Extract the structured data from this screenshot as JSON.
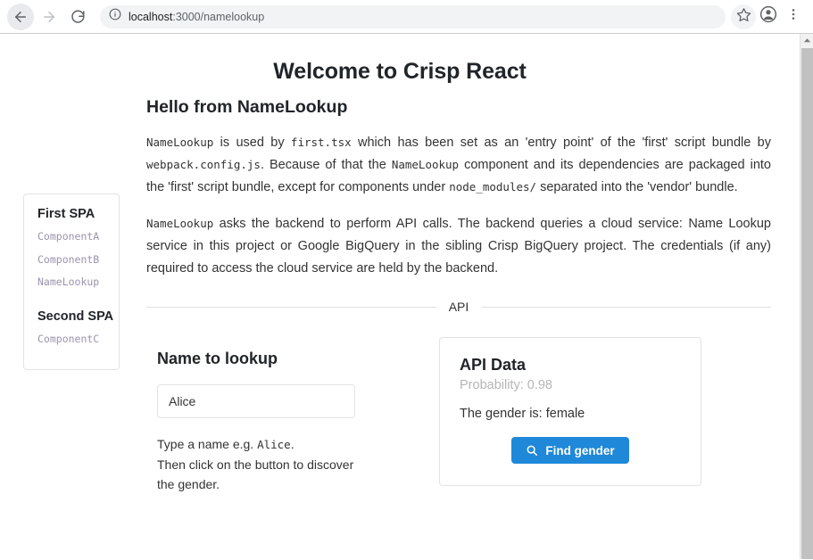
{
  "browser": {
    "back_icon": "back-arrow-icon",
    "forward_icon": "forward-arrow-icon",
    "reload_icon": "reload-icon",
    "site_info_icon": "site-info-icon",
    "url_host": "localhost",
    "url_path": ":3000/namelookup",
    "bookmark_icon": "star-icon",
    "profile_icon": "profile-avatar-icon",
    "menu_icon": "three-dot-menu-icon"
  },
  "page": {
    "title": "Welcome to Crisp React",
    "section_title": "Hello from NameLookup"
  },
  "sidebar": {
    "groups": [
      {
        "heading": "First SPA",
        "links": [
          "ComponentA",
          "ComponentB",
          "NameLookup"
        ]
      },
      {
        "heading": "Second SPA",
        "links": [
          "ComponentC"
        ]
      }
    ]
  },
  "paragraphs": {
    "p1": {
      "c1": "NameLookup",
      "t1": " is used by ",
      "c2": "first.tsx",
      "t2": " which has been set as an 'entry point' of the 'first' script bundle by ",
      "c3": "webpack.config.js",
      "t3": ". Because of that the ",
      "c4": "NameLookup",
      "t4": " component and its dependencies are packaged into the 'first' script bundle, except for components under ",
      "c5": "node_modules/",
      "t5": " separated into the 'vendor' bundle."
    },
    "p2": {
      "c1": "NameLookup",
      "t1": " asks the backend to perform API calls. The backend queries a cloud service: Name Lookup service in this project or Google BigQuery in the sibling Crisp BigQuery project. The credentials (if any) required to access the cloud service are held by the backend."
    }
  },
  "divider": {
    "label": "API"
  },
  "form": {
    "title": "Name to lookup",
    "input_value": "Alice",
    "input_placeholder": "",
    "help_prefix": "Type a name e.g. ",
    "help_code": "Alice",
    "help_suffix": ".",
    "help_line2": "Then click on the button to discover the gender."
  },
  "card": {
    "title": "API Data",
    "probability": "Probability: 0.98",
    "result": "The gender is: female",
    "button_label": "Find gender",
    "button_icon": "search-icon",
    "button_color": "#1f88d9"
  }
}
